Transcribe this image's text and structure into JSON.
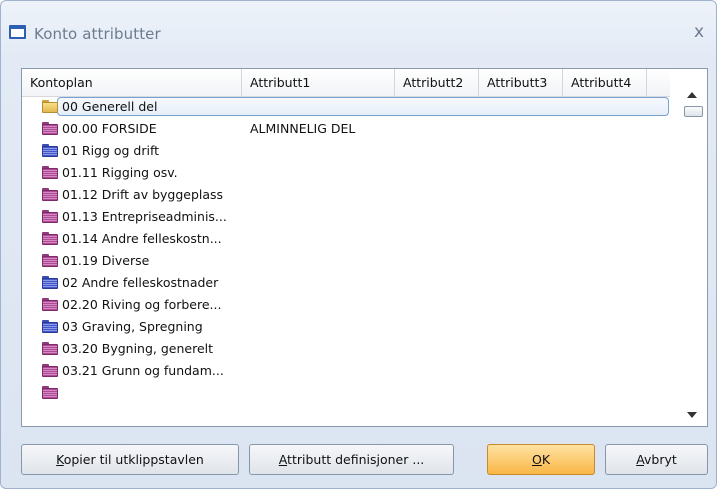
{
  "window": {
    "title": "Konto attributter",
    "close_symbol": "x"
  },
  "columns": [
    "Kontoplan",
    "Attributt1",
    "Attributt2",
    "Attributt3",
    "Attributt4"
  ],
  "rows": [
    {
      "kontoplan": "00 Generell del",
      "attr1": "",
      "folder": "yellow",
      "selected": true
    },
    {
      "kontoplan": "00.00 FORSIDE",
      "attr1": "ALMINNELIG DEL",
      "folder": "pink"
    },
    {
      "kontoplan": "01 Rigg og drift",
      "attr1": "",
      "folder": "blue"
    },
    {
      "kontoplan": "01.11 Rigging osv.",
      "attr1": "",
      "folder": "pink"
    },
    {
      "kontoplan": "01.12 Drift av byggeplass",
      "attr1": "",
      "folder": "pink"
    },
    {
      "kontoplan": "01.13 Entrepriseadminis...",
      "attr1": "",
      "folder": "pink"
    },
    {
      "kontoplan": "01.14 Andre felleskostn...",
      "attr1": "",
      "folder": "pink"
    },
    {
      "kontoplan": "01.19 Diverse",
      "attr1": "",
      "folder": "pink"
    },
    {
      "kontoplan": "02 Andre felleskostnader",
      "attr1": "",
      "folder": "blue"
    },
    {
      "kontoplan": "02.20 Riving og forbere...",
      "attr1": "",
      "folder": "pink"
    },
    {
      "kontoplan": "03 Graving, Spregning",
      "attr1": "",
      "folder": "blue"
    },
    {
      "kontoplan": "03.20 Bygning, generelt",
      "attr1": "",
      "folder": "pink"
    },
    {
      "kontoplan": "03.21 Grunn og fundam...",
      "attr1": "",
      "folder": "pink"
    },
    {
      "kontoplan": "",
      "attr1": "",
      "folder": "pink"
    }
  ],
  "buttons": {
    "copy": {
      "mnemonic": "K",
      "rest": "opier til utklippstavlen"
    },
    "attr_def": {
      "mnemonic": "A",
      "rest": "ttributt definisjoner ..."
    },
    "ok": {
      "mnemonic": "O",
      "rest": "K"
    },
    "cancel": {
      "mnemonic": "A",
      "rest": "vbryt"
    }
  },
  "colors": {
    "ok_button": "#f9b746",
    "selection_border": "#7a9fd1"
  }
}
